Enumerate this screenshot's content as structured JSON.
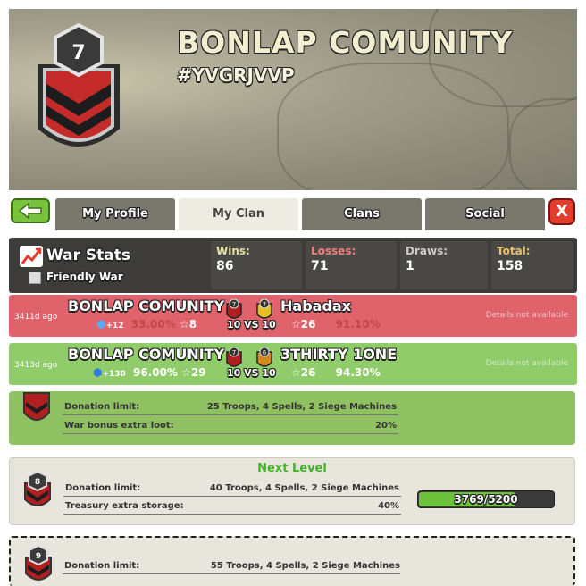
{
  "banner": {
    "clan_level": "7",
    "clan_name": "BONLAP COMUNITY",
    "clan_tag": "#YVGRJVVP"
  },
  "tabs": [
    {
      "label": "My Profile"
    },
    {
      "label": "My Clan"
    },
    {
      "label": "Clans"
    },
    {
      "label": "Social"
    }
  ],
  "close_label": "X",
  "war_stats": {
    "title": "War Stats",
    "friendly_label": "Friendly War",
    "wins_label": "Wins:",
    "wins": "86",
    "losses_label": "Losses:",
    "losses": "71",
    "draws_label": "Draws:",
    "draws": "1",
    "total_label": "Total:",
    "total": "158"
  },
  "wars": [
    {
      "ago": "3411d ago",
      "clan_a": "BONLAP COMUNITY",
      "level_a": "7",
      "level_b": "7",
      "clan_b": "Habadax",
      "xp": "+12",
      "percent_a": "33.00%",
      "stars_a": "8",
      "vs": "10 VS 10",
      "stars_b": "26",
      "percent_b": "91.10%",
      "details": "Details not available",
      "color": "#e0626b"
    },
    {
      "ago": "3413d ago",
      "clan_a": "BONLAP COMUNITY",
      "level_a": "7",
      "level_b": "6",
      "clan_b": "3THIRTY 1ONE",
      "xp": "+130",
      "percent_a": "96.00%",
      "stars_a": "29",
      "vs": "10 VS 10",
      "stars_b": "26",
      "percent_b": "94.30%",
      "details": "Details not available",
      "color": "#90cc6a"
    }
  ],
  "perks_current": {
    "donation_label": "Donation limit:",
    "donation_value": "25 Troops, 4 Spells, 2 Siege Machines",
    "bonus_label": "War bonus extra loot:",
    "bonus_value": "20%"
  },
  "perks_next": {
    "heading": "Next Level",
    "level": "8",
    "donation_label": "Donation limit:",
    "donation_value": "40 Troops, 4 Spells, 2 Siege Machines",
    "storage_label": "Treasury extra storage:",
    "storage_value": "40%",
    "progress_text": "3769/5200",
    "progress_fraction": 0.7248
  },
  "perks_future": {
    "level": "9",
    "donation_label": "Donation limit:",
    "donation_value": "55 Troops, 4 Spells, 2 Siege Machines"
  },
  "colors": {
    "loss_row": "#e0626b",
    "win_row": "#90cc6a",
    "perk_green": "#8fc163",
    "accent_green": "#79c23d",
    "close_red": "#e33c2c"
  },
  "icons": [
    "back-arrow-icon",
    "close-icon",
    "war-chart-icon",
    "star-icon",
    "xp-icon",
    "clan-badge-icon"
  ]
}
